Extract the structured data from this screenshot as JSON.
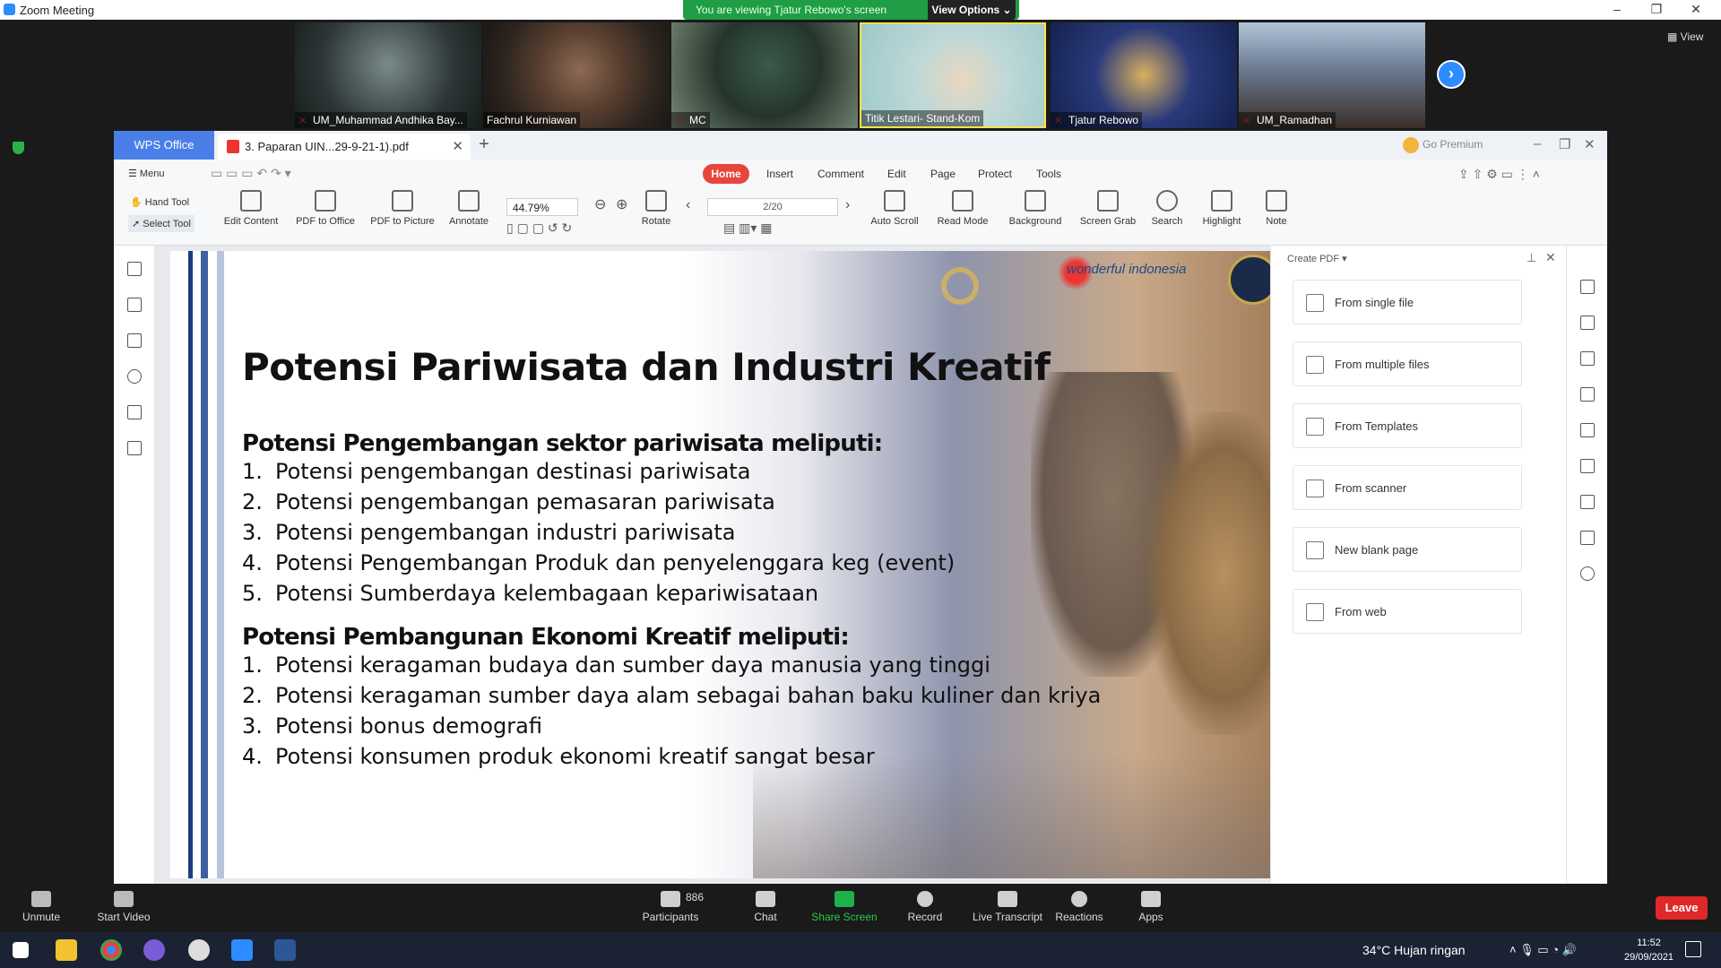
{
  "window": {
    "title": "Zoom Meeting",
    "minimize": "–",
    "maximize": "❐",
    "close": "✕"
  },
  "share_banner": {
    "message": "You are viewing Tjatur Rebowo's screen",
    "view_options": "View Options ⌄"
  },
  "participants_strip": [
    {
      "name": "UM_Muhammad Andhika Bay...",
      "muted": true
    },
    {
      "name": "Fachrul Kurniawan",
      "muted": false
    },
    {
      "name": "MC",
      "muted": true
    },
    {
      "name": "Titik Lestari- Stand-Kom",
      "muted": false
    },
    {
      "name": "Tjatur Rebowo",
      "muted": true
    },
    {
      "name": "UM_Ramadhan",
      "muted": true
    }
  ],
  "view_button": "View",
  "wps": {
    "app_tab": "WPS Office",
    "doc_tab": "3. Paparan UIN...29-9-21-1).pdf",
    "go_premium": "Go Premium",
    "menu": "Menu",
    "ribbon_tabs": [
      "Insert",
      "Comment",
      "Edit",
      "Page",
      "Protect",
      "Tools"
    ],
    "home_tab": "Home",
    "tools": {
      "hand_tool": "Hand Tool",
      "select_tool": "Select Tool",
      "edit_content": "Edit Content",
      "pdf_to_office": "PDF to Office",
      "pdf_to_picture": "PDF to Picture",
      "annotate": "Annotate",
      "rotate": "Rotate",
      "auto_scroll": "Auto Scroll",
      "read_mode": "Read Mode",
      "background": "Background",
      "screen_grab": "Screen Grab",
      "search": "Search",
      "highlight": "Highlight",
      "note": "Note"
    },
    "zoom_level": "44.79%",
    "page_indicator": "2/20",
    "create_pdf": {
      "title": "Create PDF ▾",
      "options": [
        "From single file",
        "From multiple files",
        "From Templates",
        "From scanner",
        "New blank page",
        "From web"
      ]
    }
  },
  "slide": {
    "logo_text": "wonderful indonesia",
    "title": "Potensi Pariwisata dan Industri Kreatif",
    "section1": {
      "heading": "Potensi Pengembangan sektor pariwisata meliputi:",
      "items": [
        "Potensi pengembangan destinasi pariwisata",
        "Potensi pengembangan pemasaran pariwisata",
        "Potensi pengembangan industri pariwisata",
        "Potensi Pengembangan Produk dan penyelenggara keg (event)",
        "Potensi Sumberdaya  kelembagaan kepariwisataan"
      ]
    },
    "section2": {
      "heading": "Potensi Pembangunan Ekonomi Kreatif meliputi:",
      "items": [
        "Potensi keragaman budaya dan sumber daya manusia yang tinggi",
        "Potensi keragaman sumber daya alam sebagai bahan baku kuliner dan kriya",
        "Potensi bonus demografi",
        "Potensi konsumen produk ekonomi kreatif sangat besar"
      ]
    }
  },
  "zoom_controls": {
    "unmute": "Unmute",
    "start_video": "Start Video",
    "participants": "Participants",
    "participant_count": "886",
    "chat": "Chat",
    "share_screen": "Share Screen",
    "record": "Record",
    "live_transcript": "Live Transcript",
    "reactions": "Reactions",
    "apps": "Apps",
    "leave": "Leave"
  },
  "taskbar": {
    "weather": "34°C  Hujan ringan",
    "time": "11:52",
    "date": "29/09/2021"
  },
  "colors": {
    "accent_zoom": "#2d8cff",
    "share_green": "#1f9e45",
    "wps_blue": "#4a7fe8",
    "leave_red": "#e02828",
    "home_red": "#e8453c"
  }
}
